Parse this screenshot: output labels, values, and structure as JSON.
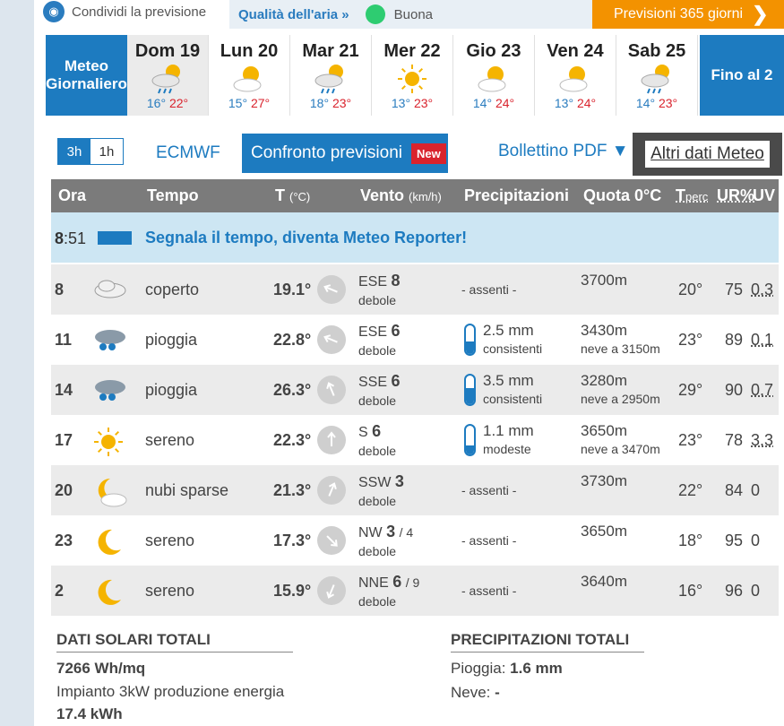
{
  "topbar": {
    "share_label": "Condividi la previsione",
    "air_label": "Qualità dell'aria »",
    "air_value": "Buona",
    "air_color": "#2ecc71",
    "forecast365_label": "Previsioni 365 giorni"
  },
  "days_nav": {
    "daily_label": "Meteo Giornaliero",
    "more_label": "Fino al 2",
    "days": [
      {
        "label": "Dom 19",
        "icon": "cloud-rain-sun-icon",
        "min": "16°",
        "max": "22°",
        "active": true
      },
      {
        "label": "Lun 20",
        "icon": "sun-cloud-icon",
        "min": "15°",
        "max": "27°"
      },
      {
        "label": "Mar 21",
        "icon": "cloud-rain-sun-icon",
        "min": "18°",
        "max": "23°"
      },
      {
        "label": "Mer 22",
        "icon": "sun-icon",
        "min": "13°",
        "max": "23°"
      },
      {
        "label": "Gio 23",
        "icon": "sun-cloud-icon",
        "min": "14°",
        "max": "24°"
      },
      {
        "label": "Ven 24",
        "icon": "sun-cloud-icon",
        "min": "13°",
        "max": "24°"
      },
      {
        "label": "Sab 25",
        "icon": "cloud-rain-sun-icon",
        "min": "14°",
        "max": "23°"
      }
    ]
  },
  "toolbar": {
    "toggle_3h": "3h",
    "toggle_1h": "1h",
    "model": "ECMWF",
    "compare_label": "Confronto previsioni",
    "new_badge": "New",
    "pdf_label": "Bollettino PDF ▼",
    "more_data_label": "Altri dati Meteo"
  },
  "table": {
    "headers": {
      "ora": "Ora",
      "tempo": "Tempo",
      "t": "T",
      "t_unit": "(°C)",
      "vento": "Vento",
      "vento_unit": "(km/h)",
      "precip": "Precipitazioni",
      "quota": "Quota 0°C",
      "tperc_t": "T",
      "tperc_sub": "perc",
      "ur": "UR%",
      "uv": "UV"
    },
    "report": {
      "hour": "8",
      "minutes": ":51",
      "message": "Segnala il tempo, diventa Meteo Reporter!"
    },
    "rows": [
      {
        "ora": "8",
        "icon": "cloud-icon",
        "desc": "coperto",
        "temp": "19.1°",
        "wind_dir": "ESE",
        "wind_speed": "8",
        "wind_gust": "",
        "wind_label": "debole",
        "prec": "- assenti -",
        "prec_mm": "",
        "prec_label": "",
        "prec_fill": 0,
        "quota": "3700m",
        "neve": "",
        "tperc": "20°",
        "ur": "75",
        "uv": "0.3"
      },
      {
        "ora": "11",
        "icon": "rain-cloud-icon",
        "desc": "pioggia",
        "temp": "22.8°",
        "wind_dir": "ESE",
        "wind_speed": "6",
        "wind_gust": "",
        "wind_label": "debole",
        "prec": "",
        "prec_mm": "2.5 mm",
        "prec_label": "consistenti",
        "prec_fill": 0.45,
        "quota": "3430m",
        "neve": "neve a 3150m",
        "tperc": "23°",
        "ur": "89",
        "uv": "0.1"
      },
      {
        "ora": "14",
        "icon": "rain-cloud-icon",
        "desc": "pioggia",
        "temp": "26.3°",
        "wind_dir": "SSE",
        "wind_speed": "6",
        "wind_gust": "",
        "wind_label": "debole",
        "prec": "",
        "prec_mm": "3.5 mm",
        "prec_label": "consistenti",
        "prec_fill": 0.55,
        "quota": "3280m",
        "neve": "neve a 2950m",
        "tperc": "29°",
        "ur": "90",
        "uv": "0.7"
      },
      {
        "ora": "17",
        "icon": "sun-icon",
        "desc": "sereno",
        "temp": "22.3°",
        "wind_dir": "S",
        "wind_speed": "6",
        "wind_gust": "",
        "wind_label": "debole",
        "prec": "",
        "prec_mm": "1.1 mm",
        "prec_label": "modeste",
        "prec_fill": 0.3,
        "quota": "3650m",
        "neve": "neve a 3470m",
        "tperc": "23°",
        "ur": "78",
        "uv": "3.3"
      },
      {
        "ora": "20",
        "icon": "moon-cloud-icon",
        "desc": "nubi sparse",
        "temp": "21.3°",
        "wind_dir": "SSW",
        "wind_speed": "3",
        "wind_gust": "",
        "wind_label": "debole",
        "prec": "- assenti -",
        "prec_mm": "",
        "prec_label": "",
        "prec_fill": 0,
        "quota": "3730m",
        "neve": "",
        "tperc": "22°",
        "ur": "84",
        "uv": "0"
      },
      {
        "ora": "23",
        "icon": "moon-icon",
        "desc": "sereno",
        "temp": "17.3°",
        "wind_dir": "NW",
        "wind_speed": "3",
        "wind_gust": "/ 4",
        "wind_label": "debole",
        "prec": "- assenti -",
        "prec_mm": "",
        "prec_label": "",
        "prec_fill": 0,
        "quota": "3650m",
        "neve": "",
        "tperc": "18°",
        "ur": "95",
        "uv": "0"
      },
      {
        "ora": "2",
        "icon": "moon-icon",
        "desc": "sereno",
        "temp": "15.9°",
        "wind_dir": "NNE",
        "wind_speed": "6",
        "wind_gust": "/ 9",
        "wind_label": "debole",
        "prec": "- assenti -",
        "prec_mm": "",
        "prec_label": "",
        "prec_fill": 0,
        "quota": "3640m",
        "neve": "",
        "tperc": "16°",
        "ur": "96",
        "uv": "0"
      }
    ]
  },
  "footer": {
    "solar_title": "DATI SOLARI TOTALI",
    "solar_value": "7266 Wh/mq",
    "solar_desc": "Impianto 3kW produzione energia",
    "solar_energy": "17.4 kWh",
    "precip_title": "PRECIPITAZIONI TOTALI",
    "rain_label": "Pioggia:",
    "rain_value": "1.6 mm",
    "snow_label": "Neve:",
    "snow_value": "-"
  }
}
